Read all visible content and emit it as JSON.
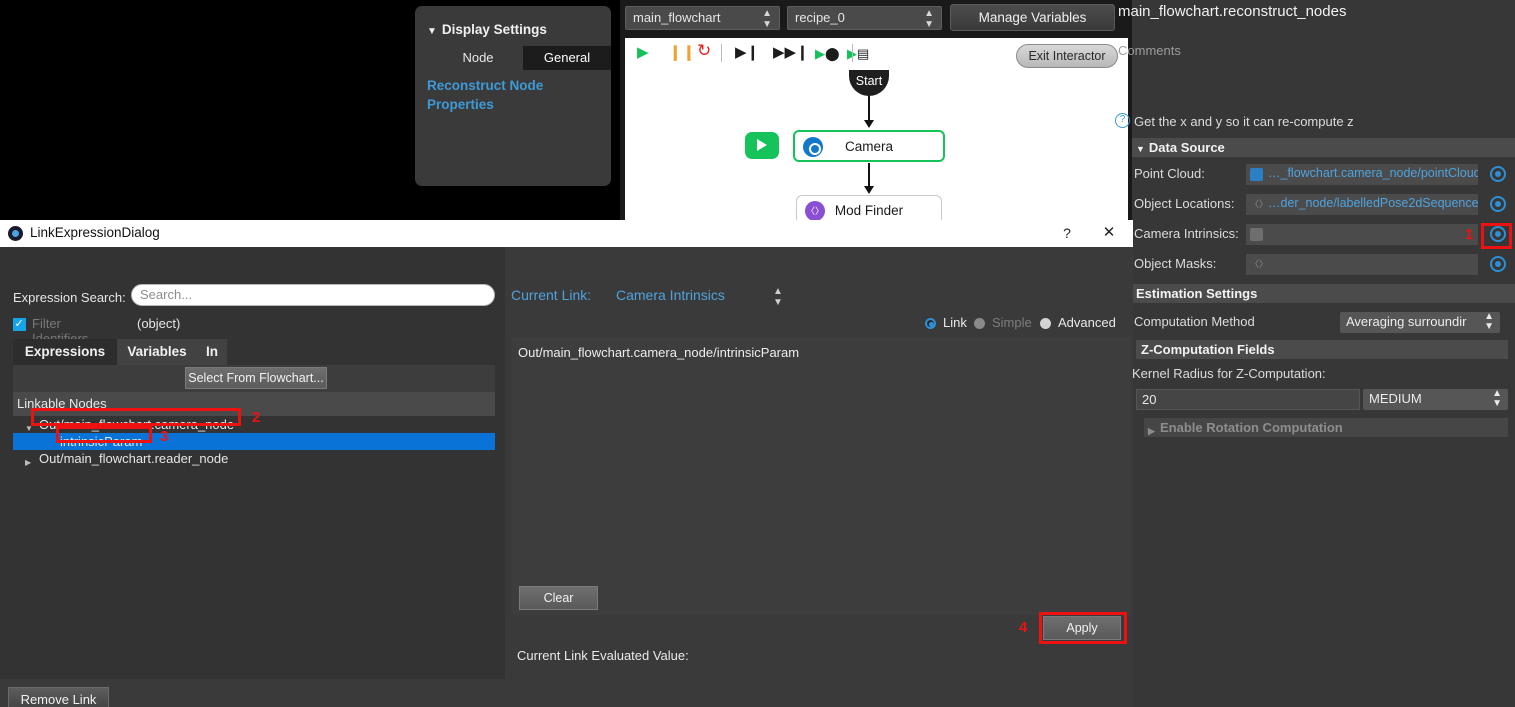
{
  "display_settings": {
    "title": "Display Settings",
    "caret": "▼",
    "tabs": [
      {
        "label": "Node",
        "active": false
      },
      {
        "label": "General",
        "active": true
      }
    ],
    "link_text": "Reconstruct Node Properties"
  },
  "flowchart": {
    "flowchart_combo": "main_flowchart",
    "recipe_combo": "recipe_0",
    "manage_variables_label": "Manage Variables",
    "exit_interactor_label": "Exit Interactor",
    "toolbar_icons": [
      "play-icon",
      "pause-icon",
      "reset-icon",
      "step-into-icon",
      "step-over-icon",
      "run-to-node-icon",
      "run-to-breakpoint-icon"
    ],
    "nodes": [
      {
        "label": "Start",
        "icon": "start-node"
      },
      {
        "label": "Camera",
        "icon": "camera-node-icon",
        "selected": true
      },
      {
        "label": "Mod Finder",
        "icon": "mod-finder-node-icon",
        "selected": false
      }
    ]
  },
  "properties_panel": {
    "title": "main_flowchart.reconstruct_nodes",
    "comments_placeholder": "Comments",
    "hint_text": "Get the x and y so it can re-compute z",
    "hint_icon": "question-icon",
    "data_source": {
      "section_title": "Data Source",
      "caret": "▼",
      "rows": [
        {
          "label": "Point Cloud:",
          "value": "…_flowchart.camera_node/pointCloud",
          "icon": "camera-icon",
          "empty": false
        },
        {
          "label": "Object Locations:",
          "value": "…der_node/labelledPose2dSequence",
          "icon": "sequence-icon",
          "empty": false
        },
        {
          "label": "Camera Intrinsics:",
          "value": "",
          "icon": "camera-icon",
          "empty": true
        },
        {
          "label": "Object Masks:",
          "value": "",
          "icon": "sequence-icon",
          "empty": true
        }
      ]
    },
    "estimation_settings": {
      "section_title": "Estimation Settings",
      "computation_method_label": "Computation Method",
      "computation_method_value": "Averaging surroundir",
      "z_fields_title": "Z-Computation Fields",
      "kernel_radius_label": "Kernel Radius for Z-Computation:",
      "kernel_radius_value": "20",
      "kernel_radius_unit": "MEDIUM",
      "rotation_section": "Enable Rotation Computation",
      "rotation_caret": "▶"
    }
  },
  "dialog": {
    "title": "LinkExpressionDialog",
    "help_glyph": "?",
    "close_glyph": "✕",
    "expression_search_label": "Expression Search:",
    "search_placeholder": "Search...",
    "filter_identifiers_label": "Filter Identifiers",
    "filter_object_label": "(object)",
    "tabs": [
      {
        "label": "Expressions",
        "active": true
      },
      {
        "label": "Variables",
        "active": false
      },
      {
        "label": "In",
        "active": false
      }
    ],
    "select_from_flowchart_label": "Select From Flowchart...",
    "linkable_nodes_header": "Linkable Nodes",
    "tree": [
      {
        "label": "Out/main_flowchart.camera_node",
        "caret": "▼",
        "indent": 0,
        "selected": false
      },
      {
        "label": "intrinsicParam",
        "caret": "",
        "indent": 1,
        "selected": true
      },
      {
        "label": "Out/main_flowchart.reader_node",
        "caret": "▶",
        "indent": 0,
        "selected": false
      }
    ],
    "remove_link_label": "Remove Link",
    "current_link_label": "Current Link:",
    "current_link_value": "Camera Intrinsics",
    "modes": [
      {
        "label": "Link",
        "selected": true,
        "disabled": false
      },
      {
        "label": "Simple",
        "selected": false,
        "disabled": true
      },
      {
        "label": "Advanced",
        "selected": false,
        "disabled": false
      }
    ],
    "expression_text": "Out/main_flowchart.camera_node/intrinsicParam",
    "clear_label": "Clear",
    "evaluated_value_label": "Current Link Evaluated Value:",
    "apply_label": "Apply"
  },
  "annotations": {
    "color": "#ee1111",
    "steps": [
      {
        "number": "1",
        "target": "camera-intrinsics-target-button"
      },
      {
        "number": "2",
        "target": "tree-node-camera-node"
      },
      {
        "number": "3",
        "target": "tree-node-intrinsic-param"
      },
      {
        "number": "4",
        "target": "apply-button"
      }
    ]
  }
}
